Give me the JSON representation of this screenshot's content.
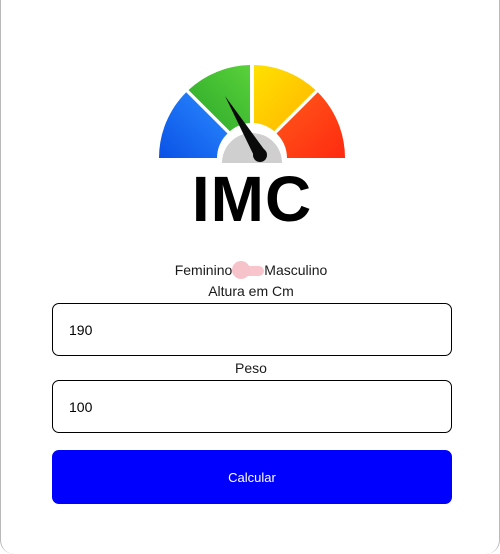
{
  "logo": {
    "text": "IMC",
    "icon": "speedometer-gauge-icon",
    "colors": [
      "#0066ff",
      "#3ec132",
      "#ffd400",
      "#ff3a1a"
    ]
  },
  "gender": {
    "left_label": "Feminino",
    "right_label": "Masculino",
    "toggle_color": "#f8c5cd"
  },
  "height_field": {
    "label": "Altura em Cm",
    "value": "190"
  },
  "weight_field": {
    "label": "Peso",
    "value": "100"
  },
  "submit": {
    "label": "Calcular",
    "color": "#0000ff"
  }
}
